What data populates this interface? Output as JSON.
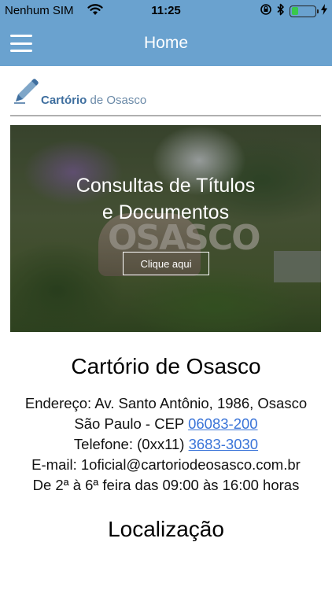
{
  "status_bar": {
    "carrier": "Nenhum SIM",
    "time": "11:25",
    "battery_level": 0.3
  },
  "nav": {
    "title": "Home"
  },
  "logo": {
    "bold": "Cartório",
    "rest": " de Osasco"
  },
  "banner": {
    "title_line1": "Consultas de Títulos",
    "title_line2": "e Documentos",
    "button_label": "Clique aqui",
    "sign_text": "OSASCO"
  },
  "info": {
    "name": "Cartório de Osasco",
    "address_line": "Endereço: Av. Santo Antônio, 1986, Osasco",
    "city_prefix": "São Paulo - CEP ",
    "cep": "06083-200",
    "phone_prefix": "Telefone: (0xx11) ",
    "phone": "3683-3030",
    "email_line": "E-mail: 1oficial@cartoriodeosasco.com.br",
    "hours_line": "De 2ª à 6ª feira das 09:00 às 16:00 horas"
  },
  "section": {
    "location_title": "Localização"
  },
  "colors": {
    "nav_bg": "#6aa2cf",
    "link": "#3a74d8",
    "battery": "#39c84b"
  }
}
